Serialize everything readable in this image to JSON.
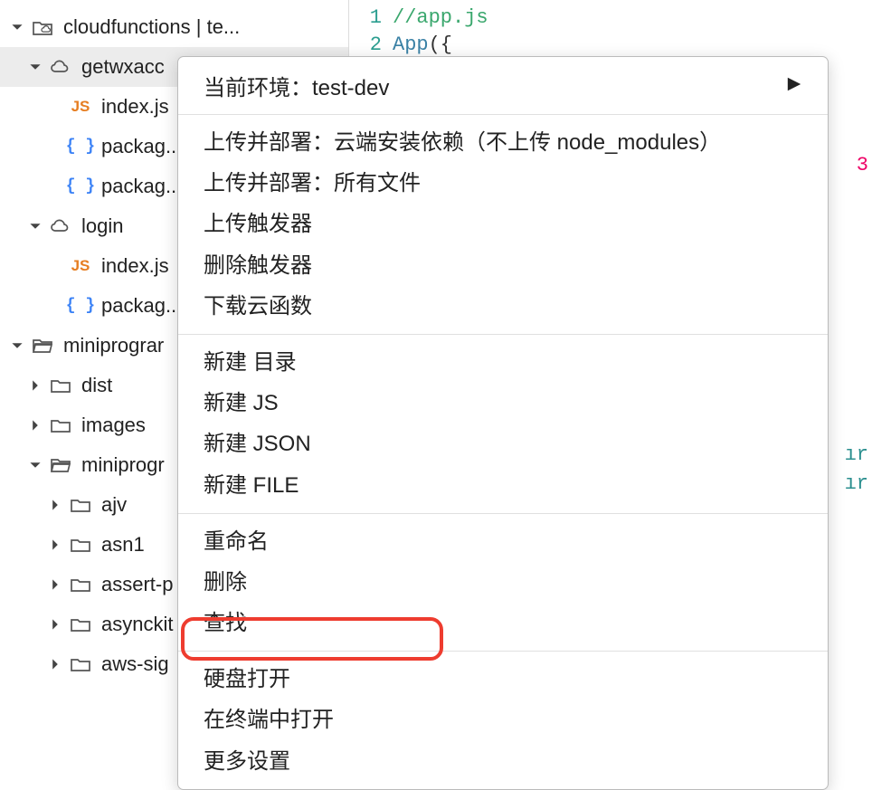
{
  "tree": {
    "cloudfunctions": "cloudfunctions | te...",
    "getwxacc": "getwxacc",
    "index_js": "index.js",
    "package1": "packag...",
    "package2": "packag...",
    "login": "login",
    "login_index": "index.js",
    "login_packag": "packag...",
    "miniprogram": "miniprograr",
    "dist": "dist",
    "images": "images",
    "miniprogr": "miniprogr",
    "ajv": "ajv",
    "asn1": "asn1",
    "assert_p": "assert-p",
    "asynckit": "asynckit",
    "aws_sig": "aws-sig"
  },
  "editor": {
    "line1_num": "1",
    "line1_text": "//app.js",
    "line2_num": "2",
    "line2_ident": "App",
    "line2_rest": "({",
    "stray1": "3",
    "stray2": "ır",
    "stray3": "ır"
  },
  "menu": {
    "header": "当前环境：test-dev",
    "s1_i1": "上传并部署：云端安装依赖（不上传 node_modules）",
    "s1_i2": "上传并部署：所有文件",
    "s1_i3": "上传触发器",
    "s1_i4": "删除触发器",
    "s1_i5": "下载云函数",
    "s2_i1": "新建 目录",
    "s2_i2": "新建 JS",
    "s2_i3": "新建 JSON",
    "s2_i4": "新建 FILE",
    "s3_i1": "重命名",
    "s3_i2": "删除",
    "s3_i3": "查找",
    "s4_i1": "硬盘打开",
    "s4_i2": "在终端中打开",
    "s4_i3": "更多设置"
  }
}
